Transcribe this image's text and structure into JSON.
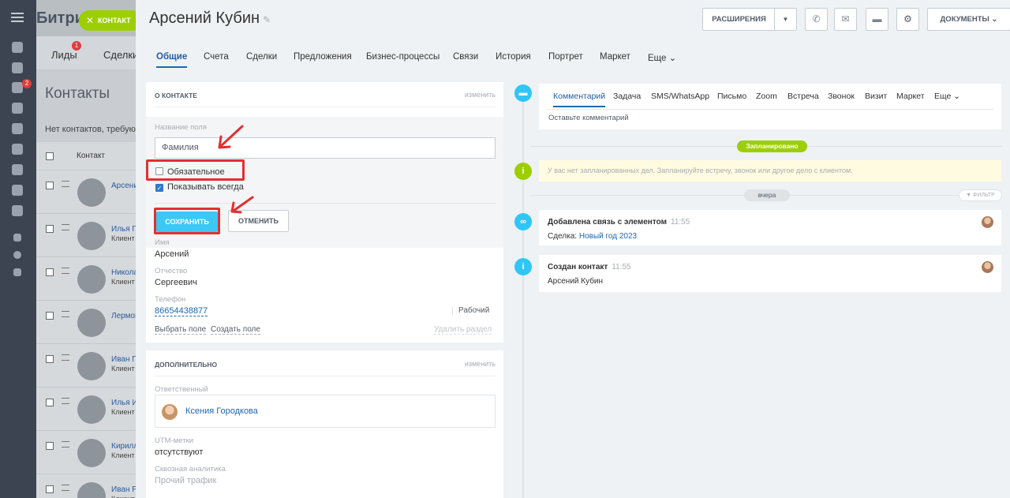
{
  "background": {
    "brand": "Битри",
    "nav": {
      "leads": "Лиды",
      "leads_badge": "1",
      "deals": "Сделки"
    },
    "menu_badge": "2",
    "title": "Контакты",
    "subtitle": "Нет контактов, требующ",
    "table_header": "Контакт",
    "rows": [
      {
        "name": "Арсени",
        "type": ""
      },
      {
        "name": "Илья П",
        "type": "Клиент"
      },
      {
        "name": "Никола",
        "type": "Клиент"
      },
      {
        "name": "Лермон",
        "type": ""
      },
      {
        "name": "Иван Гр",
        "type": "Клиент"
      },
      {
        "name": "Илья И",
        "type": "Клиент"
      },
      {
        "name": "Кирилл",
        "type": "Клиент"
      },
      {
        "name": "Иван Р",
        "type": "Клиент"
      }
    ]
  },
  "close_chip": {
    "label": "КОНТАКТ",
    "icon": "close-icon"
  },
  "header": {
    "title": "Арсений Кубин",
    "extensions_label": "РАСШИРЕНИЯ",
    "documents_label": "ДОКУМЕНТЫ",
    "icons": [
      "phone-icon",
      "mail-icon",
      "chat-icon",
      "gear-icon"
    ]
  },
  "tabs": [
    "Общие",
    "Счета",
    "Сделки",
    "Предложения",
    "Бизнес-процессы",
    "Связи",
    "История",
    "Портрет",
    "Маркет",
    "Еще"
  ],
  "about": {
    "title": "О КОНТАКТЕ",
    "edit": "изменить",
    "field_name_label": "Название поля",
    "field_name_value": "Фамилия",
    "required_label": "Обязательное",
    "always_show_label": "Показывать всегда",
    "save": "СОХРАНИТЬ",
    "cancel": "ОТМЕНИТЬ",
    "fields": {
      "name_label": "Имя",
      "name_value": "Арсений",
      "patronymic_label": "Отчество",
      "patronymic_value": "Сергеевич",
      "phone_label": "Телефон",
      "phone_value": "86654438877",
      "phone_type": "Рабочий"
    },
    "select_field": "Выбрать поле",
    "create_field": "Создать поле",
    "delete_section": "Удалить раздел"
  },
  "additional": {
    "title": "ДОПОЛНИТЕЛЬНО",
    "edit": "изменить",
    "responsible_label": "Ответственный",
    "responsible_name": "Ксения Городкова",
    "utm_label": "UTM-метки",
    "utm_value": "отсутствуют",
    "analytics_label": "Сквозная аналитика",
    "analytics_value": "Прочий трафик"
  },
  "timeline": {
    "comment_tabs": [
      "Комментарий",
      "Задача",
      "SMS/WhatsApp",
      "Письмо",
      "Zoom",
      "Встреча",
      "Звонок",
      "Визит",
      "Маркет",
      "Еще"
    ],
    "comment_placeholder": "Оставьте комментарий",
    "planned": "Запланировано",
    "no_planned": "У вас нет запланированных дел. Запланируйте встречу, звонок или другое дело с клиентом.",
    "yesterday": "вчера",
    "filter": "ФИЛЬТР",
    "events": [
      {
        "title": "Добавлена связь с элементом",
        "time": "11:55",
        "body_label": "Сделка:",
        "body_link": "Новый год 2023"
      },
      {
        "title": "Создан контакт",
        "time": "11:55",
        "body": "Арсений Кубин"
      }
    ]
  },
  "colors": {
    "accent": "#2067b0",
    "save_button": "#3bc8f5",
    "highlight": "#e13030",
    "green": "#9dcf00"
  }
}
